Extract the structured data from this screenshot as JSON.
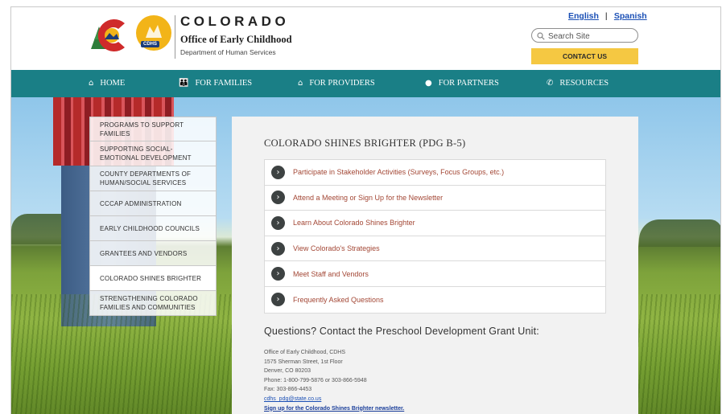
{
  "header": {
    "brand_title": "COLORADO",
    "brand_subtitle": "Office of Early Childhood",
    "brand_dept": "Department of Human Services",
    "cdhs_label": "CDHS",
    "lang_english": "English",
    "lang_sep": "|",
    "lang_spanish": "Spanish",
    "search_placeholder": "Search Site",
    "contact_label": "CONTACT US"
  },
  "nav": {
    "items": [
      {
        "label": "HOME",
        "icon": "home-icon"
      },
      {
        "label": "FOR FAMILIES",
        "icon": "family-icon"
      },
      {
        "label": "FOR PROVIDERS",
        "icon": "building-icon"
      },
      {
        "label": "FOR PARTNERS",
        "icon": "person-icon"
      },
      {
        "label": "RESOURCES",
        "icon": "phone-icon"
      }
    ]
  },
  "sidebar": {
    "items": [
      {
        "label": "PROGRAMS TO SUPPORT FAMILIES"
      },
      {
        "label": "SUPPORTING SOCIAL-EMOTIONAL DEVELOPMENT"
      },
      {
        "label": "COUNTY DEPARTMENTS OF HUMAN/SOCIAL SERVICES"
      },
      {
        "label": "CCCAP ADMINISTRATION"
      },
      {
        "label": "EARLY CHILDHOOD COUNCILS"
      },
      {
        "label": "GRANTEES AND VENDORS"
      },
      {
        "label": "COLORADO SHINES BRIGHTER"
      },
      {
        "label": "STRENGTHENING COLORADO FAMILIES AND COMMUNITIES"
      }
    ]
  },
  "main": {
    "title": "COLORADO SHINES BRIGHTER (PDG B-5)",
    "links": [
      {
        "label": "Participate in Stakeholder Activities (Surveys, Focus Groups, etc.)"
      },
      {
        "label": "Attend a Meeting or Sign Up for the Newsletter"
      },
      {
        "label": "Learn About Colorado Shines Brighter"
      },
      {
        "label": "View Colorado's Strategies"
      },
      {
        "label": "Meet Staff and Vendors"
      },
      {
        "label": "Frequently Asked Questions"
      }
    ],
    "contact_heading": "Questions? Contact the Preschool Development Grant Unit:",
    "address": {
      "line1": "Office of Early Childhood, CDHS",
      "line2": "1575 Sherman Street, 1st Floor",
      "line3": "Denver, CO 80203",
      "phone": "Phone: 1-800-799-5876 or 303-866-5948",
      "fax": "Fax: 303-866-4453",
      "email": "cdhs_pdg@state.co.us",
      "newsletter": "Sign up for the Colorado Shines Brighter newsletter."
    }
  },
  "colors": {
    "nav_bg": "#1a7f86",
    "contact_bg": "#f5c842",
    "link_color": "#a34735",
    "lang_link": "#1a4fb5"
  }
}
